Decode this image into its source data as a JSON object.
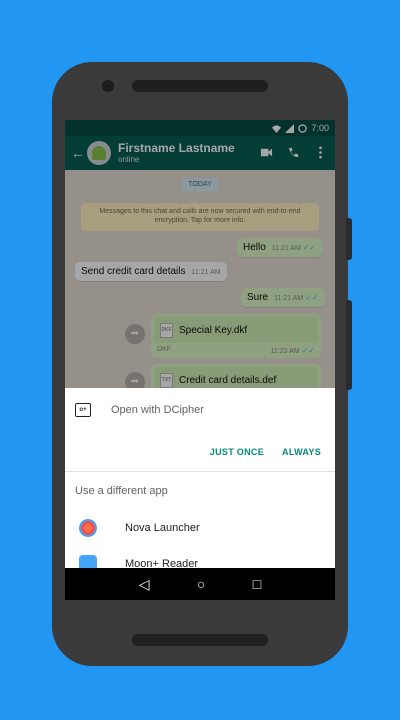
{
  "status_bar": {
    "time": "7:00"
  },
  "app_bar": {
    "contact_name": "Firstname Lastname",
    "contact_status": "online",
    "back_icon": "arrow-back-icon",
    "video_icon": "videocam-icon",
    "call_icon": "phone-icon",
    "menu_icon": "more-vert-icon"
  },
  "chat": {
    "date_label": "TODAY",
    "encryption_notice": "Messages to this chat and calls are now secured with end-to-end encryption. Tap for more info.",
    "messages": [
      {
        "text": "Hello",
        "time": "11:21 AM"
      },
      {
        "text": "Send credit card details",
        "time": "11:21 AM"
      },
      {
        "text": "Sure",
        "time": "11:21 AM"
      }
    ],
    "files": [
      {
        "name": "Special Key.dkf",
        "type": "DKF",
        "time": "11:23 AM"
      },
      {
        "name": "Credit card details.def",
        "type": "TXT"
      }
    ]
  },
  "sheet": {
    "open_with_label": "Open with DCipher",
    "just_once": "JUST ONCE",
    "always": "ALWAYS",
    "different_app": "Use a different app",
    "apps": [
      {
        "name": "Nova Launcher"
      },
      {
        "name": "Moon+ Reader"
      }
    ]
  },
  "colors": {
    "background": "#2196F3",
    "appbar": "#075e54",
    "accent": "#00897b",
    "outgoing_bubble": "#dcf8c6"
  }
}
